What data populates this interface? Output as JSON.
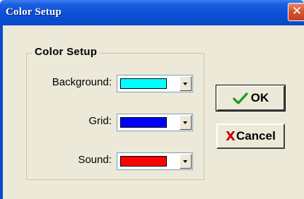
{
  "window": {
    "title": "Color Setup",
    "close_glyph": "✕"
  },
  "group": {
    "title": "Color Setup",
    "rows": [
      {
        "label": "Background:",
        "color": "#00ffff"
      },
      {
        "label": "Grid:",
        "color": "#0000ff"
      },
      {
        "label": "Sound:",
        "color": "#ff0000"
      }
    ]
  },
  "buttons": {
    "ok_label": "OK",
    "ok_icon": "check-icon",
    "ok_icon_color": "#1a9a1a",
    "cancel_label": "Cancel",
    "cancel_icon_glyph": "X",
    "cancel_icon_color": "#cc0000"
  },
  "colors": {
    "titlebar": "#0a4fd8",
    "face": "#ece9d8"
  }
}
